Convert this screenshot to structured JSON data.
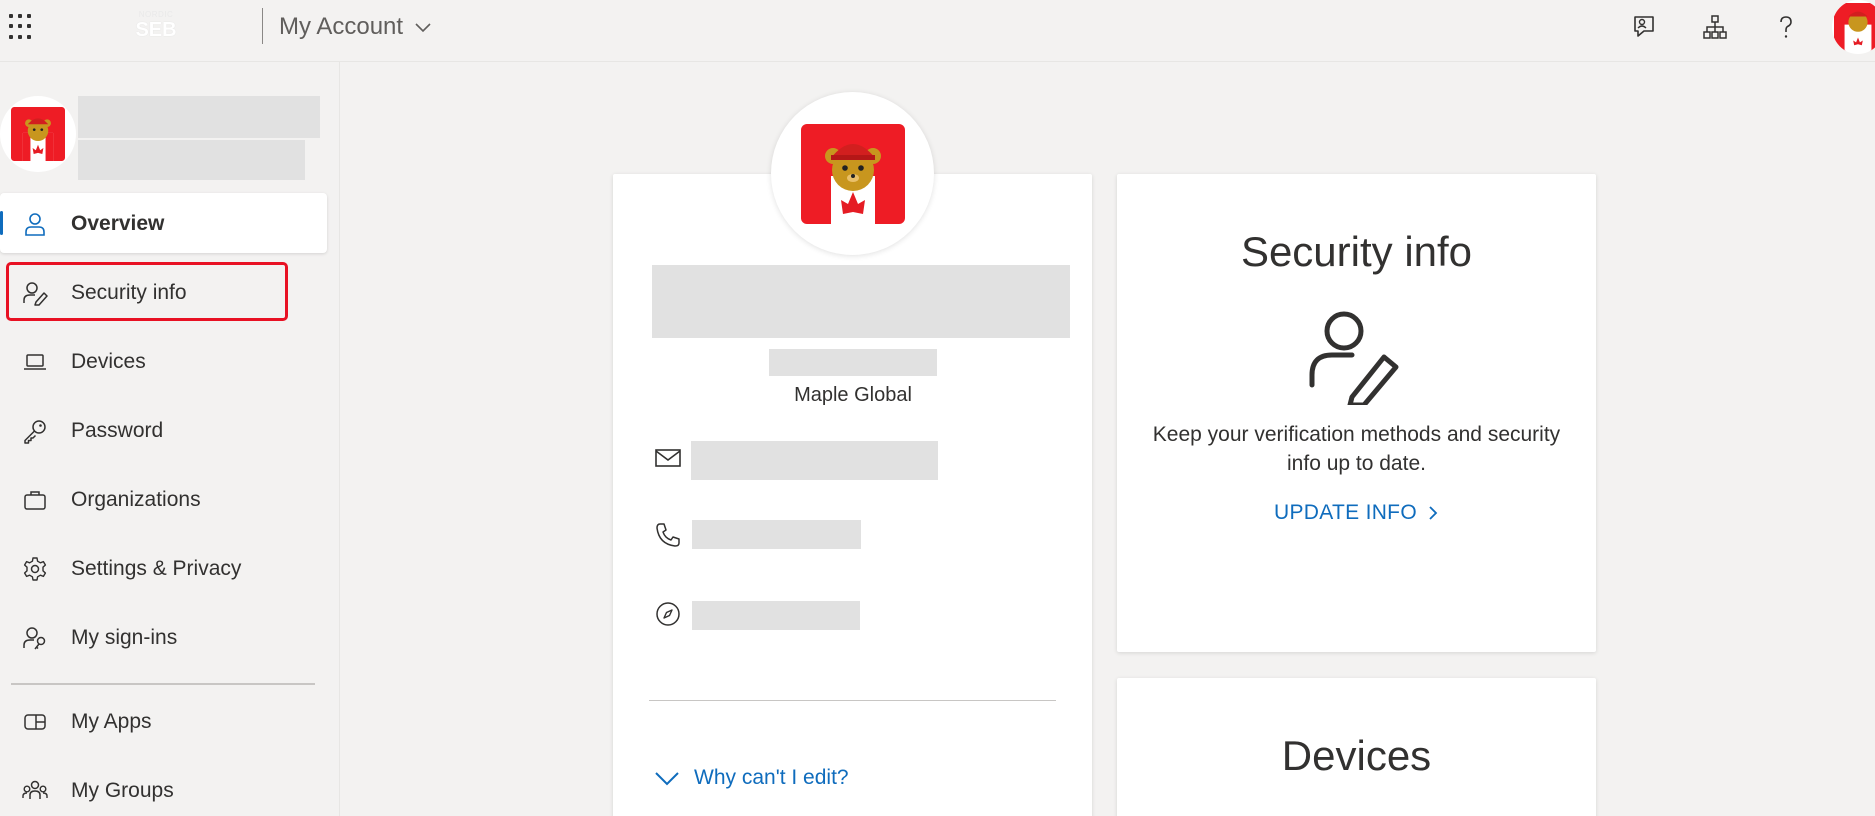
{
  "header": {
    "brand_top": "NORDIC",
    "brand_name": "SEB",
    "app_title": "My Account"
  },
  "sidebar": {
    "items": [
      {
        "label": "Overview",
        "icon": "person-icon",
        "active": true
      },
      {
        "label": "Security info",
        "icon": "person-pen-icon",
        "highlighted": true
      },
      {
        "label": "Devices",
        "icon": "laptop-icon"
      },
      {
        "label": "Password",
        "icon": "key-icon"
      },
      {
        "label": "Organizations",
        "icon": "briefcase-icon"
      },
      {
        "label": "Settings & Privacy",
        "icon": "gear-icon"
      },
      {
        "label": "My sign-ins",
        "icon": "person-key-icon"
      },
      {
        "label": "My Apps",
        "icon": "apps-icon"
      },
      {
        "label": "My Groups",
        "icon": "people-group-icon"
      }
    ]
  },
  "profile": {
    "organization": "Maple Global",
    "why_link": "Why can't I edit?"
  },
  "security_card": {
    "title": "Security info",
    "description": "Keep your verification methods and security info up to date.",
    "link": "UPDATE INFO"
  },
  "devices_card": {
    "title": "Devices"
  },
  "colors": {
    "accent": "#0f6cbd",
    "highlight_border": "#e81123",
    "background": "#f3f2f1",
    "placeholder": "#e1e1e1"
  }
}
